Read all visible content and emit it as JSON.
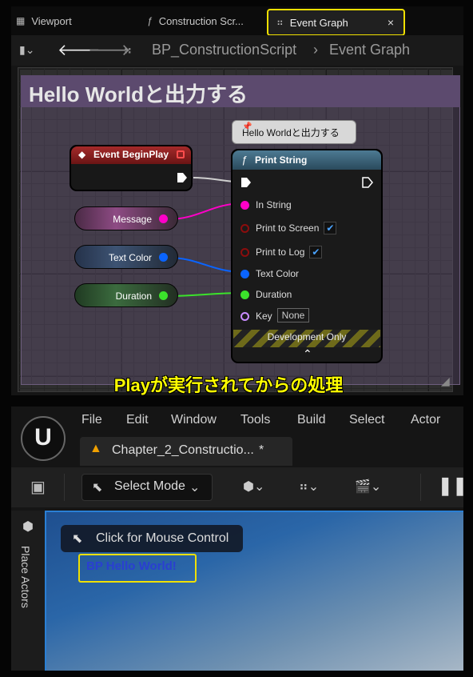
{
  "tabs": [
    {
      "label": "Viewport"
    },
    {
      "label": "Construction Scr..."
    },
    {
      "label": "Event Graph"
    }
  ],
  "toolbar": {
    "breadcrumb_blueprint": "BP_ConstructionScript",
    "breadcrumb_sep": "›",
    "breadcrumb_graph": "Event Graph"
  },
  "comment": {
    "title": "Hello Worldと出力する"
  },
  "event_node": {
    "title": "Event BeginPlay"
  },
  "variables": [
    {
      "label": "Message",
      "color": "#ff00c8"
    },
    {
      "label": "Text Color",
      "color": "#0a64ff"
    },
    {
      "label": "Duration",
      "color": "#3be22b"
    }
  ],
  "print_string": {
    "bubble": "Hello Worldと出力する",
    "title": "Print String",
    "pins": {
      "in_string": "In String",
      "print_to_screen": "Print to Screen",
      "print_to_log": "Print to Log",
      "text_color": "Text Color",
      "duration": "Duration",
      "key": "Key",
      "key_value": "None"
    },
    "footer": "Development Only"
  },
  "annotation": "Playが実行されてからの処理",
  "menu": [
    "File",
    "Edit",
    "Window",
    "Tools",
    "Build",
    "Select",
    "Actor"
  ],
  "level_tab": {
    "title": "Chapter_2_Constructio...",
    "modified": "*"
  },
  "select_mode": "Select Mode",
  "place_actors": "Place Actors",
  "viewport": {
    "click_mouse": "Click for Mouse Control",
    "output": "BP Hello World!"
  },
  "colors": {
    "highlight": "#f0e000",
    "exec": "#ffffff"
  }
}
